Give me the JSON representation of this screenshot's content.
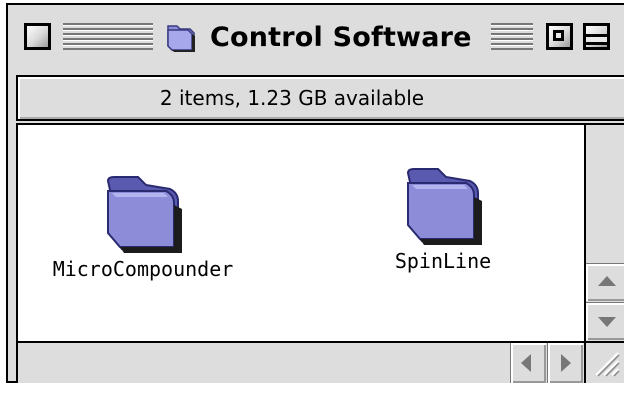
{
  "window": {
    "title": "Control Software",
    "title_icon": "folder-icon"
  },
  "header": {
    "info": "2 items, 1.23 GB available"
  },
  "items": [
    {
      "label": "MicroCompounder",
      "icon": "folder-icon"
    },
    {
      "label": "SpinLine",
      "icon": "folder-icon"
    }
  ],
  "colors": {
    "window_bg": "#dddddd",
    "content_bg": "#ffffff",
    "folder_fill": "#8c8cd8",
    "folder_dark": "#5a5ab0",
    "folder_shadow": "#333333"
  }
}
